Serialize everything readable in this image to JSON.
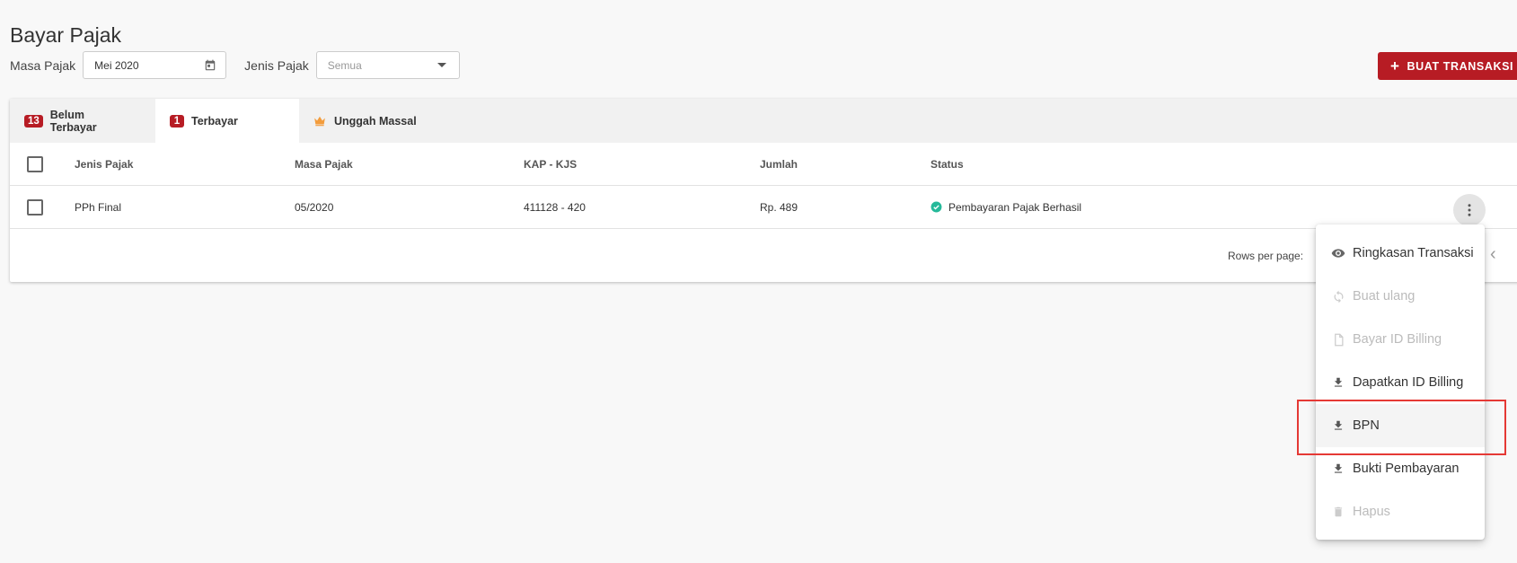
{
  "page": {
    "title": "Bayar Pajak"
  },
  "filters": {
    "masa_pajak_label": "Masa Pajak",
    "masa_pajak_value": "Mei 2020",
    "jenis_pajak_label": "Jenis Pajak",
    "jenis_pajak_value": "Semua"
  },
  "actions": {
    "create_label": "BUAT TRANSAKSI BARU"
  },
  "tabs": [
    {
      "badge": "13",
      "label": "Belum Terbayar"
    },
    {
      "badge": "1",
      "label": "Terbayar",
      "active": true
    },
    {
      "icon": "crown-icon",
      "label": "Unggah Massal"
    }
  ],
  "table": {
    "headers": [
      "Jenis Pajak",
      "Masa Pajak",
      "KAP - KJS",
      "Jumlah",
      "Status"
    ],
    "rows": [
      {
        "jenis_pajak": "PPh Final",
        "masa_pajak": "05/2020",
        "kap_kjs": "411128 - 420",
        "jumlah": "Rp. 489",
        "status": "Pembayaran Pajak Berhasil"
      }
    ]
  },
  "footer": {
    "rows_per_page_label": "Rows per page:"
  },
  "menu": {
    "items": [
      {
        "label": "Ringkasan Transaksi",
        "icon": "eye-icon",
        "disabled": false
      },
      {
        "label": "Buat ulang",
        "icon": "refresh-icon",
        "disabled": true
      },
      {
        "label": "Bayar ID Billing",
        "icon": "file-icon",
        "disabled": true
      },
      {
        "label": "Dapatkan ID Billing",
        "icon": "download-icon",
        "disabled": false
      },
      {
        "label": "BPN",
        "icon": "download-icon",
        "disabled": false
      },
      {
        "label": "Bukti Pembayaran",
        "icon": "download-icon",
        "disabled": false
      },
      {
        "label": "Hapus",
        "icon": "trash-icon",
        "disabled": true
      }
    ]
  },
  "colors": {
    "brand_red": "#b71c24",
    "success": "#26b99a",
    "highlight": "#e53935",
    "crown": "#f39c3c"
  }
}
